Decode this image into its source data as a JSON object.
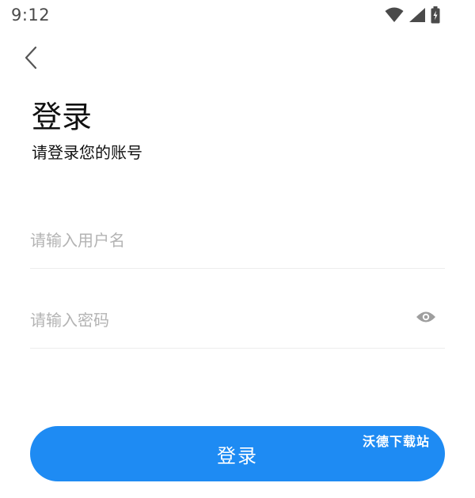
{
  "status_bar": {
    "time": "9:12",
    "icons": [
      "wifi-icon",
      "cell-signal-icon",
      "battery-charging-icon"
    ]
  },
  "nav": {
    "back_icon": "chevron-left-icon"
  },
  "header": {
    "title": "登录",
    "subtitle": "请登录您的账号"
  },
  "form": {
    "username": {
      "placeholder": "请输入用户名",
      "value": ""
    },
    "password": {
      "placeholder": "请输入密码",
      "value": "",
      "toggle_icon": "eye-icon"
    },
    "submit_label": "登录"
  },
  "watermark": {
    "text": "沃德下载站"
  },
  "colors": {
    "accent": "#1e8bf3",
    "placeholder": "#b3b3b3",
    "divider": "#ececec",
    "icon_gray": "#9e9e9e"
  }
}
